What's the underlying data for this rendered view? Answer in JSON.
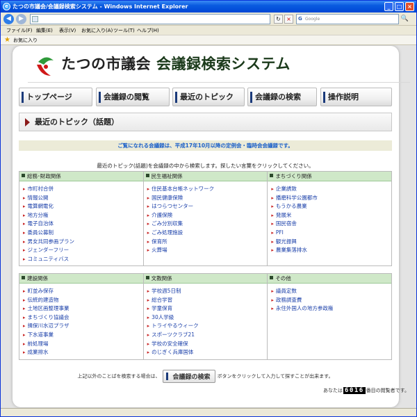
{
  "window": {
    "title": "たつの市議会/会議録検索システム - Windows Internet Explorer",
    "min": "_",
    "max": "□",
    "close": "×"
  },
  "toolbar": {
    "back": "◀",
    "forward": "▶",
    "address": "",
    "refresh": "↻",
    "stop": "×",
    "search_placeholder": "Google",
    "search_go": "🔍"
  },
  "menu": [
    "ファイル(F)",
    "編集(E)",
    "表示(V)",
    "お気に入り(A)",
    "ツール(T)",
    "ヘルプ(H)"
  ],
  "favorites": {
    "label": "お気に入り"
  },
  "site": {
    "title_main": "たつの市議会",
    "title_sub": "会議録検索システム"
  },
  "nav": [
    {
      "label": "トップページ"
    },
    {
      "label": "会議録の閲覧"
    },
    {
      "label": "最近のトピック"
    },
    {
      "label": "会議録の検索"
    },
    {
      "label": "操作説明"
    }
  ],
  "topic_header": "最近のトピック（話題）",
  "notice": "ご覧になれる会議録は、平成17年10月以降の定例会・臨時会会議録です。",
  "intro": "最近のトピック(話題)を会議録の中から検索します。探したい言葉をクリックしてください。",
  "categories_row1": [
    {
      "title": "総務･財政関係",
      "items": [
        "市町村合併",
        "情報公開",
        "電算網電化",
        "地方分権",
        "電子自治体",
        "委員公募制",
        "男女共同参画プラン",
        "ジェンダーフリー",
        "コミュニティバス"
      ]
    },
    {
      "title": "民生福祉関係",
      "items": [
        "住民基本台帳ネットワーク",
        "国民健康保険",
        "はつらつセンター",
        "介護保険",
        "ごみ分別収集",
        "ごみ処理施設",
        "保育所",
        "火葬場"
      ]
    },
    {
      "title": "まちづくり関係",
      "items": [
        "企業誘致",
        "播磨科学公園都市",
        "もうかる農業",
        "発展米",
        "国民宿舎",
        "PFI",
        "観光振興",
        "農業集落排水"
      ]
    }
  ],
  "categories_row2": [
    {
      "title": "建設関係",
      "items": [
        "町並み保存",
        "伝統的建造物",
        "土地区画整理事業",
        "まちづくり協議会",
        "揖保川水辺プラザ",
        "下水道事業",
        "前処理場",
        "成業排水"
      ]
    },
    {
      "title": "文教関係",
      "items": [
        "学校週5日制",
        "総合学習",
        "学童保育",
        "30人学級",
        "トライやるウィーク",
        "スポーツクラブ21",
        "学校の安全確保",
        "のじぎく兵庫国体"
      ]
    },
    {
      "title": "その他",
      "items": [
        "議員定数",
        "政務調査費",
        "永住外国人の地方参政権"
      ]
    }
  ],
  "footer": {
    "before": "上記以外のことばを検索する場合は、",
    "button": "会議録の検索",
    "after": "ボタンをクリックして入力して探すことが出来ます。"
  },
  "counter": {
    "before": "あなたは",
    "value": "6016",
    "after": "番目の閲覧者です。"
  }
}
